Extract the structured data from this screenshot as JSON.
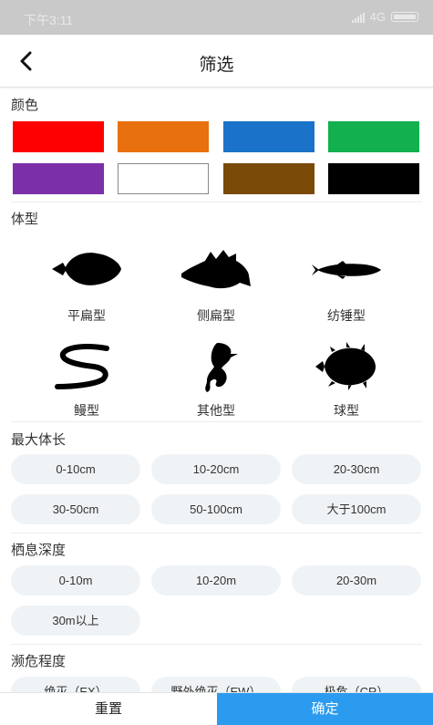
{
  "status_bar": {
    "time": "下午3:11",
    "network": "4G",
    "signal_icon": "signal-icon",
    "battery_icon": "battery-icon"
  },
  "header": {
    "title": "筛选",
    "back_icon": "chevron-left-icon"
  },
  "color_section": {
    "title": "颜色",
    "swatches": [
      "#ff0000",
      "#e8700f",
      "#1a73c8",
      "#12b04f",
      "#7b2fa8",
      "#ffffff",
      "#7a4a09",
      "#000000"
    ]
  },
  "body_type_section": {
    "title": "体型",
    "items": [
      {
        "label": "平扁型",
        "icon": "flatfish-icon"
      },
      {
        "label": "侧扁型",
        "icon": "butterflyfish-icon"
      },
      {
        "label": "纺锤型",
        "icon": "spindle-fish-icon"
      },
      {
        "label": "鳗型",
        "icon": "eel-icon"
      },
      {
        "label": "其他型",
        "icon": "seahorse-icon"
      },
      {
        "label": "球型",
        "icon": "pufferfish-icon"
      }
    ]
  },
  "max_length_section": {
    "title": "最大体长",
    "options": [
      "0-10cm",
      "10-20cm",
      "20-30cm",
      "30-50cm",
      "50-100cm",
      "大于100cm"
    ]
  },
  "depth_section": {
    "title": "栖息深度",
    "options": [
      "0-10m",
      "10-20m",
      "20-30m",
      "30m以上"
    ]
  },
  "endangered_section": {
    "title": "濒危程度",
    "options": [
      "绝灭（EX）",
      "野外绝灭（EW）",
      "极危（CR）"
    ]
  },
  "footer": {
    "reset_label": "重置",
    "confirm_label": "确定"
  }
}
